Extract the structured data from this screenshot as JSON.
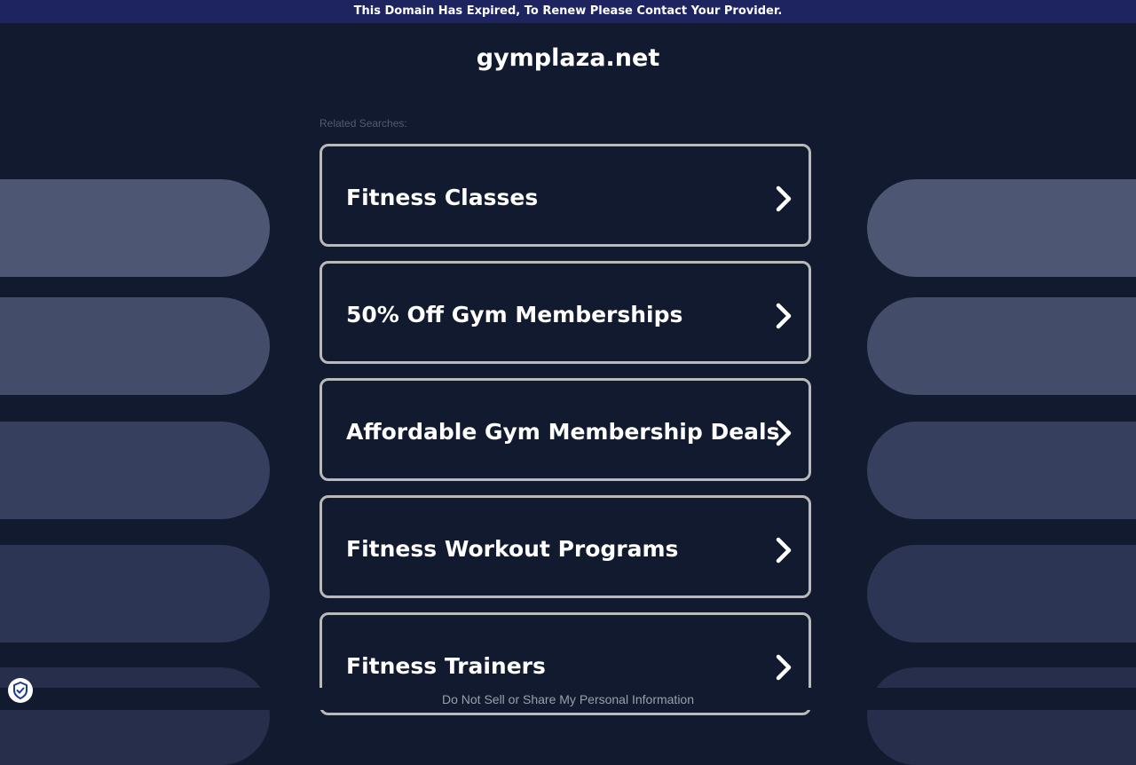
{
  "banner": {
    "text": "This Domain Has Expired, To Renew Please Contact Your Provider."
  },
  "site": {
    "domain": "gymplaza.net"
  },
  "related": {
    "label": "Related Searches:",
    "items": [
      {
        "label": "Fitness Classes"
      },
      {
        "label": "50% Off Gym Memberships"
      },
      {
        "label": "Affordable Gym Membership Deals"
      },
      {
        "label": "Fitness Workout Programs"
      },
      {
        "label": "Fitness Trainers"
      }
    ]
  },
  "footer": {
    "privacy_link": "Do Not Sell or Share My Personal Information"
  },
  "colors": {
    "background": "#111a2e",
    "banner": "#1d2460",
    "item_border": "#b9b9b9",
    "label_muted": "#525b72",
    "pill_shades": [
      "#4d5672",
      "#434c68",
      "#363f5d",
      "#2d3554",
      "#262e4c"
    ]
  },
  "icons": {
    "item_arrow": "chevron-right-icon",
    "privacy": "shield-check-icon"
  }
}
